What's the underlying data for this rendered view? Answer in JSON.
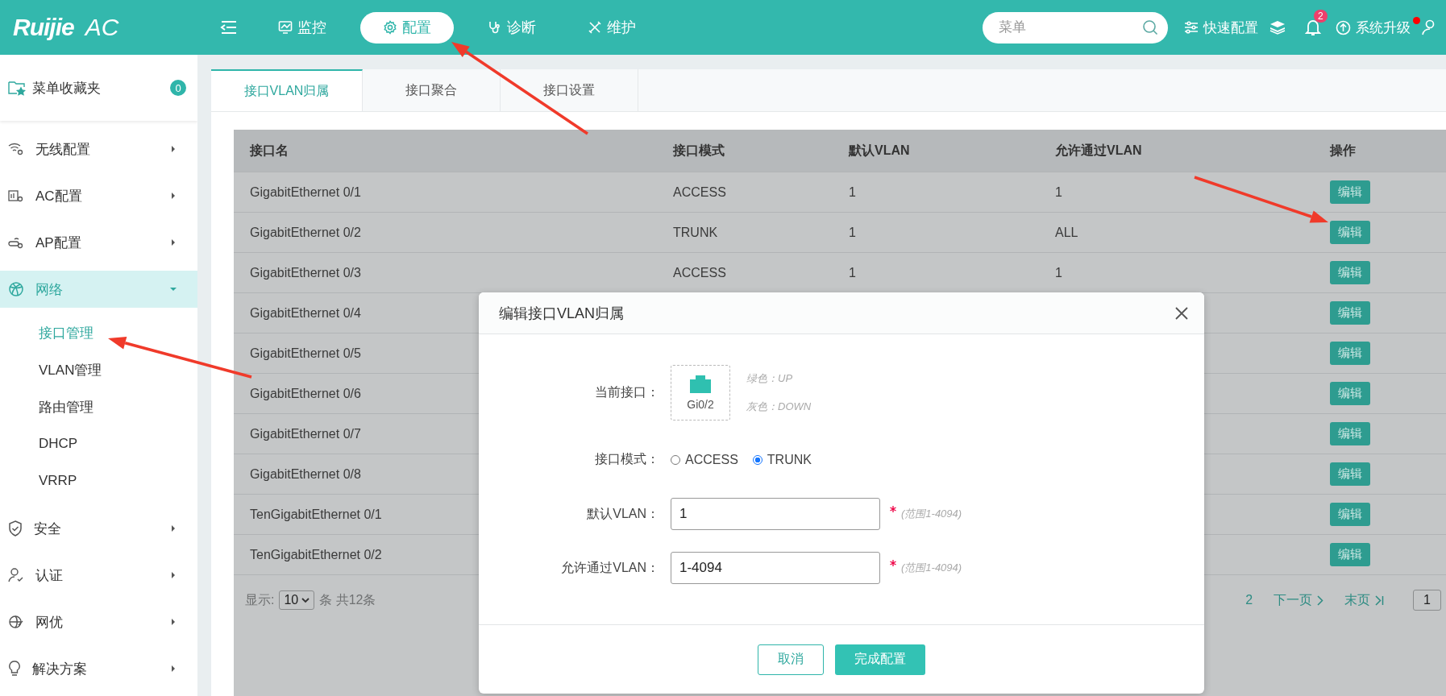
{
  "header": {
    "logo": "Ruijie",
    "product": "AC",
    "nav": [
      {
        "label": "监控",
        "selected": false
      },
      {
        "label": "配置",
        "selected": true
      },
      {
        "label": "诊断",
        "selected": false
      },
      {
        "label": "维护",
        "selected": false
      }
    ],
    "search": {
      "placeholder": "菜单"
    },
    "quick_config": "快速配置",
    "notifications": "2",
    "upgrade": "系统升级",
    "upgrade_alert": true
  },
  "sidebar": {
    "favorites": {
      "label": "菜单收藏夹",
      "count": "0"
    },
    "items": [
      {
        "label": "无线配置",
        "expanded": false
      },
      {
        "label": "AC配置",
        "expanded": false
      },
      {
        "label": "AP配置",
        "expanded": false
      },
      {
        "label": "网络",
        "expanded": true,
        "children": [
          {
            "label": "接口管理",
            "selected": true
          },
          {
            "label": "VLAN管理",
            "selected": false
          },
          {
            "label": "路由管理",
            "selected": false
          },
          {
            "label": "DHCP",
            "selected": false
          },
          {
            "label": "VRRP",
            "selected": false
          }
        ]
      },
      {
        "label": "安全",
        "expanded": false
      },
      {
        "label": "认证",
        "expanded": false
      },
      {
        "label": "网优",
        "expanded": false
      },
      {
        "label": "解决方案",
        "expanded": false
      }
    ]
  },
  "tabs": [
    {
      "label": "接口VLAN归属",
      "selected": true
    },
    {
      "label": "接口聚合",
      "selected": false
    },
    {
      "label": "接口设置",
      "selected": false
    }
  ],
  "table": {
    "columns": [
      "接口名",
      "接口模式",
      "默认VLAN",
      "允许通过VLAN",
      "操作"
    ],
    "rows": [
      {
        "cells": [
          "GigabitEthernet 0/1",
          "ACCESS",
          "1",
          "1"
        ],
        "action": "编辑"
      },
      {
        "cells": [
          "GigabitEthernet 0/2",
          "TRUNK",
          "1",
          "ALL"
        ],
        "action": "编辑"
      },
      {
        "cells": [
          "GigabitEthernet 0/3",
          "ACCESS",
          "1",
          "1"
        ],
        "action": "编辑"
      },
      {
        "cells": [
          "GigabitEthernet 0/4"
        ],
        "action": "编辑"
      },
      {
        "cells": [
          "GigabitEthernet 0/5"
        ],
        "action": "编辑"
      },
      {
        "cells": [
          "GigabitEthernet 0/6"
        ],
        "action": "编辑"
      },
      {
        "cells": [
          "GigabitEthernet 0/7"
        ],
        "action": "编辑"
      },
      {
        "cells": [
          "GigabitEthernet 0/8"
        ],
        "action": "编辑"
      },
      {
        "cells": [
          "TenGigabitEthernet 0/1"
        ],
        "action": "编辑"
      },
      {
        "cells": [
          "TenGigabitEthernet 0/2"
        ],
        "action": "编辑"
      }
    ]
  },
  "pagination": {
    "show_label": "显示:",
    "page_size": "10",
    "summary": "条 共12条",
    "page": "2",
    "next": "下一页",
    "last": "末页",
    "page_input": "1"
  },
  "dialog": {
    "title": "编辑接口VLAN归属",
    "port_label": "当前接口：",
    "port": "Gi0/2",
    "port_up": true,
    "legend": [
      "绿色：UP",
      "灰色：DOWN"
    ],
    "mode_label": "接口模式：",
    "modes": [
      {
        "label": "ACCESS",
        "selected": false
      },
      {
        "label": "TRUNK",
        "selected": true
      }
    ],
    "fields": [
      {
        "label": "默认VLAN：",
        "value": "1",
        "required": true,
        "hint": "(范围1-4094)"
      },
      {
        "label": "允许通过VLAN：",
        "value": "1-4094",
        "required": true,
        "hint": "(范围1-4094)"
      }
    ],
    "buttons": [
      {
        "label": "取消",
        "kind": "secondary"
      },
      {
        "label": "完成配置",
        "kind": "primary"
      }
    ]
  }
}
